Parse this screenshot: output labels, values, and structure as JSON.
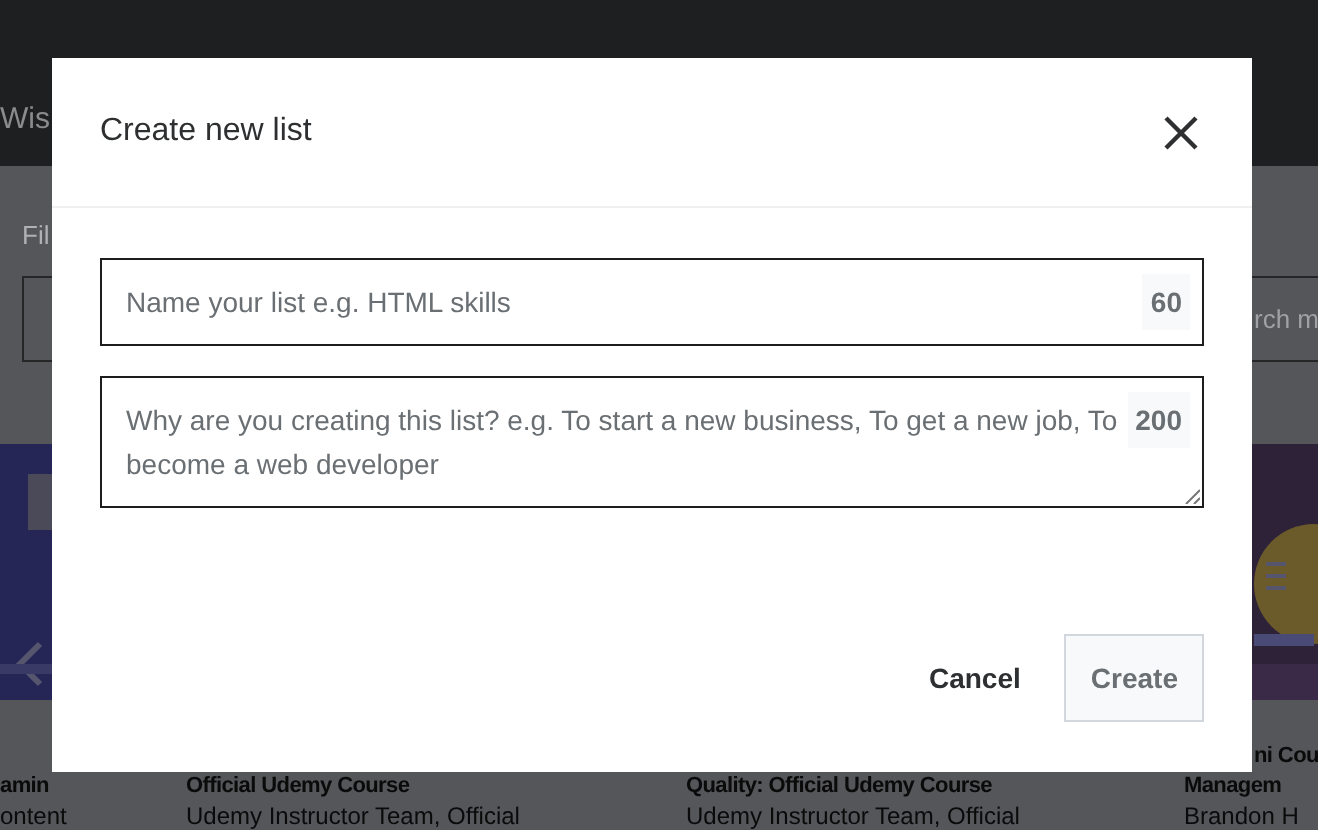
{
  "background": {
    "header_text": "Wis",
    "filter_label": "Fil",
    "search_placeholder": "rch m",
    "cards": [
      {
        "title": [
          "amin"
        ],
        "byline": "ontent"
      },
      {
        "title": [
          "Official Udemy Course"
        ],
        "byline": "Udemy Instructor Team, Official"
      },
      {
        "title": [
          "Quality: Official Udemy Course"
        ],
        "byline": "Udemy Instructor Team, Official"
      },
      {
        "title": [
          "ni Cou",
          "Managem"
        ],
        "byline": "Brandon H"
      }
    ]
  },
  "dialog": {
    "title": "Create new list",
    "fields": [
      {
        "kind": "input",
        "placeholder": "Name your list e.g. HTML skills",
        "counter": "60"
      },
      {
        "kind": "textarea",
        "placeholder": "Why are you creating this list? e.g. To start a new business, To get a new job, To become a web developer",
        "counter": "200"
      }
    ],
    "buttons": [
      {
        "label": "Cancel",
        "kind": "text",
        "disabled": false
      },
      {
        "label": "Create",
        "kind": "primary",
        "disabled": true
      }
    ]
  }
}
